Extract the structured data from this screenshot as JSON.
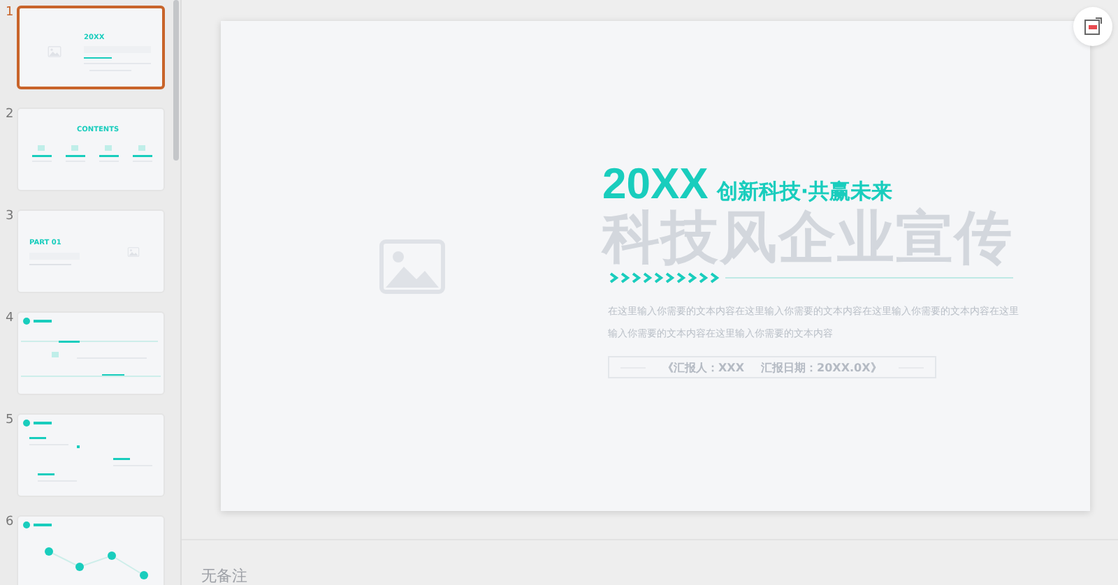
{
  "thumbnails": [
    {
      "number": "1",
      "selected": true,
      "kind": "cover",
      "label": "20XX"
    },
    {
      "number": "2",
      "selected": false,
      "kind": "contents",
      "label": "CONTENTS"
    },
    {
      "number": "3",
      "selected": false,
      "kind": "part",
      "label": "PART 01"
    },
    {
      "number": "4",
      "selected": false,
      "kind": "steps"
    },
    {
      "number": "5",
      "selected": false,
      "kind": "points"
    },
    {
      "number": "6",
      "selected": false,
      "kind": "timeline"
    }
  ],
  "slide": {
    "year": "20XX",
    "subtitle": "创新科技·共赢未来",
    "title": "科技风企业宣传",
    "body": "在这里输入你需要的文本内容在这里输入你需要的文本内容在这里输入你需要的文本内容在这里输入你需要的文本内容在这里输入你需要的文本内容",
    "reporter": "《汇报人：XXX",
    "date": "汇报日期：20XX.0X》"
  },
  "notes": {
    "placeholder": "无备注"
  }
}
